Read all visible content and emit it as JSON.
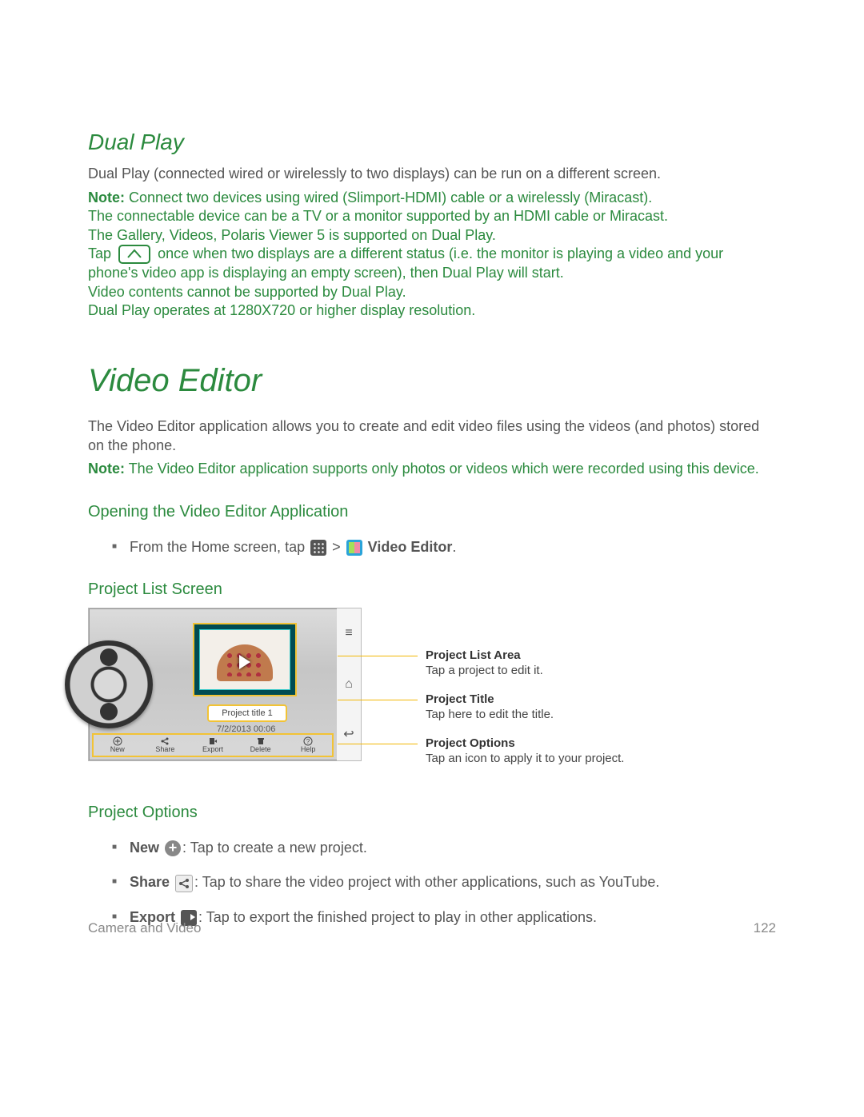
{
  "dualPlay": {
    "heading": "Dual Play",
    "intro": "Dual Play (connected wired or wirelessly to two displays) can be run on a different screen.",
    "noteLabel": "Note:",
    "noteLines": [
      "Connect two devices using wired (Slimport-HDMI) cable or a wirelessly (Miracast).",
      "The connectable device can be a TV or a monitor supported by an HDMI cable or Miracast.",
      "The Gallery, Videos, Polaris Viewer 5 is supported on Dual Play.",
      "Tap",
      "once when two displays are a different status (i.e. the monitor is playing a video and your phone's video app is displaying an empty screen), then Dual Play will start.",
      "Video contents cannot be supported by Dual Play.",
      "Dual Play operates at 1280X720 or higher display resolution."
    ]
  },
  "videoEditor": {
    "heading": "Video Editor",
    "intro": "The Video Editor application allows you to create and edit video files using the videos (and photos) stored on the phone.",
    "noteLabel": "Note:",
    "noteText": "The Video Editor application supports only photos or videos which were recorded using this device.",
    "openHeading": "Opening the Video Editor Application",
    "openBullet": {
      "pre": "From the Home screen, tap",
      "sep": ">",
      "appName": "Video Editor",
      "dot": "."
    },
    "listHeading": "Project List Screen",
    "screenshot": {
      "projectTitle": "Project title 1",
      "date": "7/2/2013 00:06",
      "bottom": [
        "New",
        "Share",
        "Export",
        "Delete",
        "Help"
      ],
      "side": [
        "≡",
        "⌂",
        "↩"
      ]
    },
    "callouts": [
      {
        "title": "Project List Area",
        "desc": "Tap a project to edit it."
      },
      {
        "title": "Project Title",
        "desc": "Tap here to edit the title."
      },
      {
        "title": "Project Options",
        "desc": "Tap an icon to apply it to your project."
      }
    ],
    "optionsHeading": "Project Options",
    "options": [
      {
        "name": "New",
        "desc": ": Tap to create a new project."
      },
      {
        "name": "Share",
        "desc": ": Tap to share the video project with other applications, such as YouTube."
      },
      {
        "name": "Export",
        "desc": ": Tap to export the finished project to play in other applications."
      }
    ]
  },
  "footer": {
    "left": "Camera and Video",
    "right": "122"
  }
}
